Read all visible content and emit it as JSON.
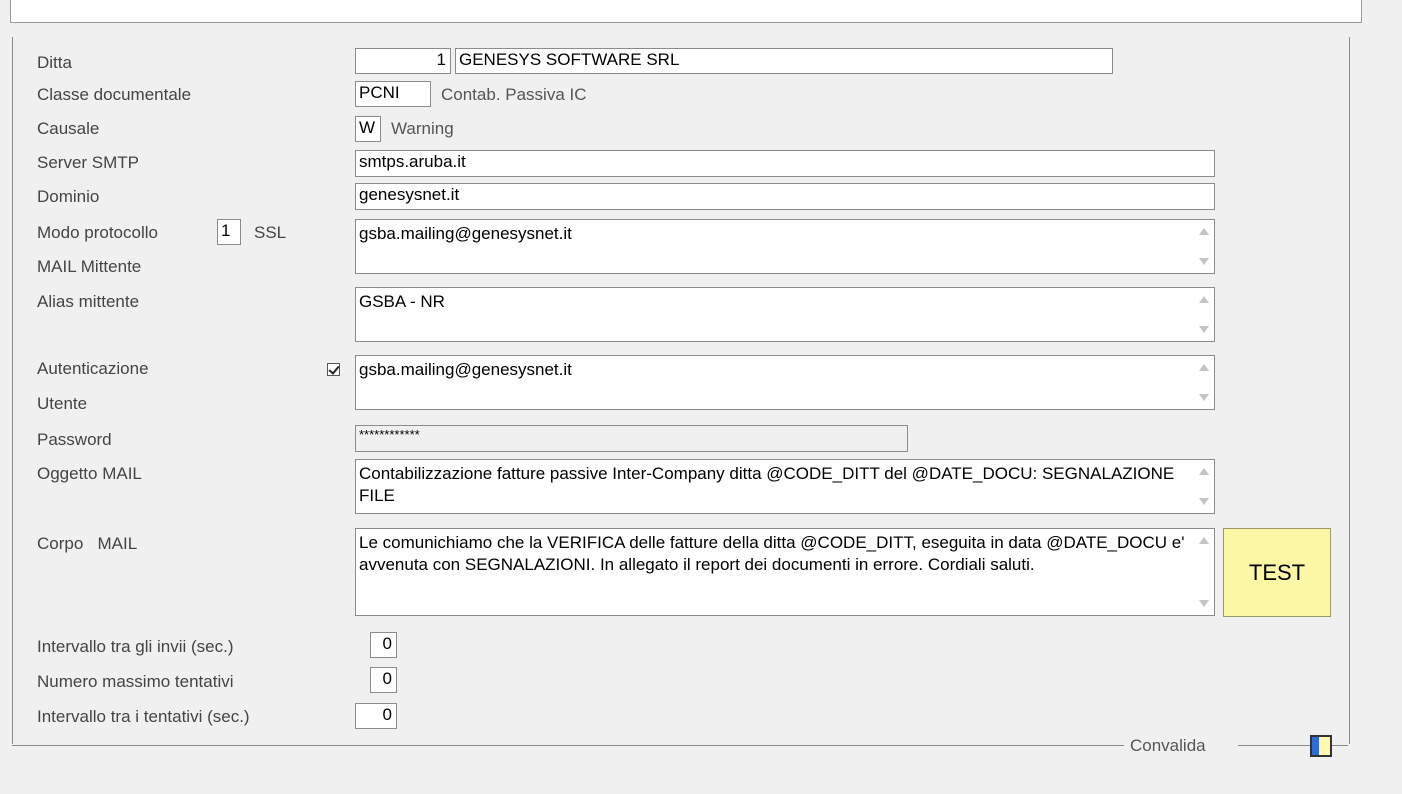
{
  "form": {
    "ditta": {
      "label": "Ditta",
      "code": "1",
      "name": "GENESYS SOFTWARE SRL"
    },
    "classe": {
      "label": "Classe documentale",
      "code": "PCNI",
      "description": "Contab. Passiva IC"
    },
    "causale": {
      "label": "Causale",
      "code": "W",
      "description": "Warning"
    },
    "server_smtp": {
      "label": "Server SMTP",
      "value": "smtps.aruba.it"
    },
    "dominio": {
      "label": "Dominio",
      "value": "genesysnet.it"
    },
    "modo_protocollo": {
      "label": "Modo protocollo",
      "code": "1",
      "description": "SSL"
    },
    "mail_mittente": {
      "label": "MAIL Mittente",
      "value": "gsba.mailing@genesysnet.it"
    },
    "alias_mittente": {
      "label": "Alias mittente",
      "value": "GSBA - NR"
    },
    "autenticazione": {
      "label": "Autenticazione",
      "checked": true
    },
    "utente": {
      "label": "Utente",
      "value": "gsba.mailing@genesysnet.it"
    },
    "password": {
      "label": "Password",
      "value": "************"
    },
    "oggetto_mail": {
      "label": "Oggetto MAIL",
      "value": "Contabilizzazione fatture passive Inter-Company ditta @CODE_DITT del @DATE_DOCU: SEGNALAZIONE FILE"
    },
    "corpo_mail": {
      "label": "Corpo   MAIL",
      "value": "Le comunichiamo che la VERIFICA delle fatture della ditta @CODE_DITT, eseguita in data @DATE_DOCU e' avvenuta con SEGNALAZIONI. In allegato il report dei documenti in errore. Cordiali saluti."
    },
    "intervallo_invii": {
      "label": "Intervallo tra gli invii (sec.)",
      "value": "0"
    },
    "numero_tentativi": {
      "label": "Numero massimo tentativi",
      "value": "0"
    },
    "intervallo_tentativi": {
      "label": "Intervallo tra i tentativi (sec.)",
      "value": "0"
    }
  },
  "buttons": {
    "test_label": "TEST",
    "convalida_label": "Convalida"
  },
  "colors": {
    "test_button_bg": "#fbf7a4",
    "convalida_accent": "#2f6bd9"
  }
}
